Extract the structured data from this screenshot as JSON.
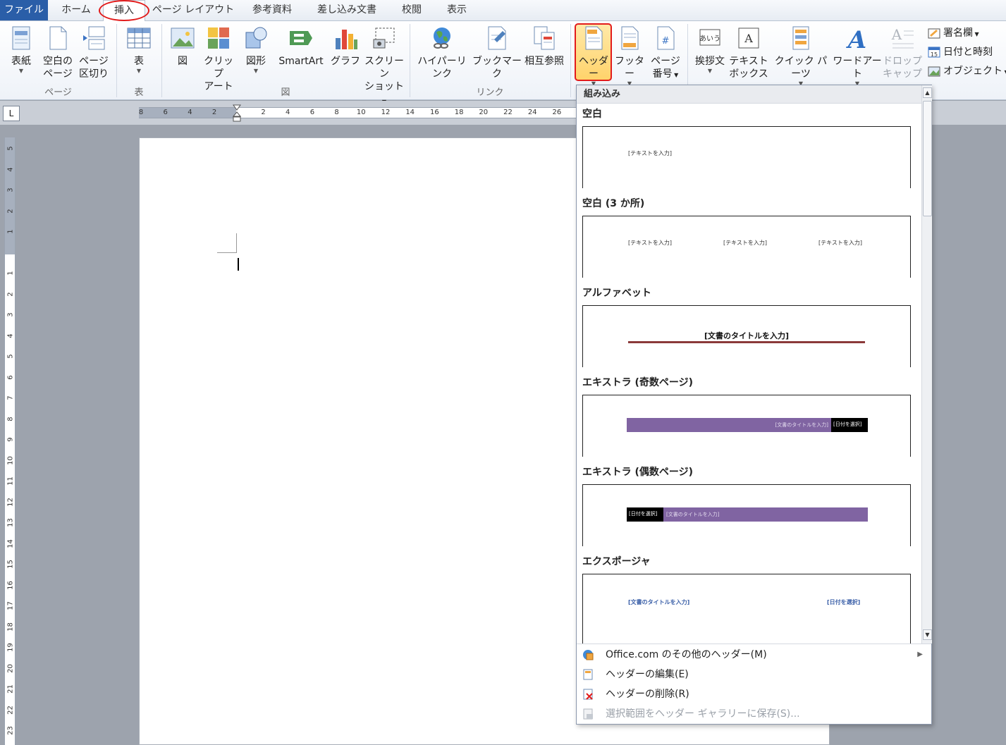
{
  "tabs": [
    "ファイル",
    "ホーム",
    "挿入",
    "ページ レイアウト",
    "参考資料",
    "差し込み文書",
    "校閲",
    "表示"
  ],
  "ribbon": {
    "pages": {
      "cover": "表紙",
      "blank_1": "空白の",
      "blank_2": "ページ",
      "break_1": "ページ",
      "break_2": "区切り",
      "group": "ページ"
    },
    "table": {
      "table": "表",
      "group": "表"
    },
    "illustrations": {
      "picture": "図",
      "clipart_1": "クリップ",
      "clipart_2": "アート",
      "shapes": "図形",
      "smartart": "SmartArt",
      "chart": "グラフ",
      "screenshot_1": "スクリーン",
      "screenshot_2": "ショット",
      "group": "図"
    },
    "links": {
      "hyperlink": "ハイパーリンク",
      "bookmark": "ブックマーク",
      "crossref": "相互参照",
      "group": "リンク"
    },
    "header_footer": {
      "header": "ヘッダー",
      "footer": "フッター",
      "pagenum_1": "ページ",
      "pagenum_2": "番号"
    },
    "text": {
      "greeting": "挨拶文",
      "textbox_1": "テキスト",
      "textbox_2": "ボックス",
      "quickparts": "クイック パーツ",
      "wordart": "ワードアート",
      "dropcap_1": "ドロップ",
      "dropcap_2": "キャップ",
      "signature": "署名欄",
      "datetime": "日付と時刻",
      "object": "オブジェクト"
    }
  },
  "ruler": {
    "corner": "L",
    "h_ticks": [
      "8",
      "6",
      "4",
      "2",
      "2",
      "4",
      "6",
      "8",
      "10",
      "12",
      "14",
      "16",
      "18",
      "20",
      "22",
      "24",
      "26"
    ],
    "v_ticks": [
      "5",
      "4",
      "3",
      "2",
      "1",
      "1",
      "2",
      "3",
      "4",
      "5",
      "6",
      "7",
      "8",
      "9",
      "10",
      "11",
      "12",
      "13",
      "14",
      "15",
      "16",
      "17",
      "18",
      "19",
      "20",
      "21",
      "22",
      "23"
    ]
  },
  "gallery": {
    "section_header": "組み込み",
    "items": [
      {
        "title": "空白",
        "placeholders": [
          "[テキストを入力]"
        ]
      },
      {
        "title": "空白 (3 か所)",
        "placeholders": [
          "[テキストを入力]",
          "[テキストを入力]",
          "[テキストを入力]"
        ]
      },
      {
        "title": "アルファベット",
        "placeholders": [
          "[文書のタイトルを入力]"
        ]
      },
      {
        "title": "エキストラ (奇数ページ)",
        "placeholders": [
          "[文書のタイトルを入力]",
          "[日付を選択]"
        ]
      },
      {
        "title": "エキストラ (偶数ページ)",
        "placeholders": [
          "[日付を選択]",
          "[文書のタイトルを入力]"
        ]
      },
      {
        "title": "エクスポージャ",
        "placeholders": [
          "[文書のタイトルを入力]",
          "[日付を選択]"
        ]
      }
    ],
    "menu": [
      {
        "label": "Office.com のその他のヘッダー(M)",
        "enabled": true
      },
      {
        "label": "ヘッダーの編集(E)",
        "enabled": true
      },
      {
        "label": "ヘッダーの削除(R)",
        "enabled": true
      },
      {
        "label": "選択範囲をヘッダー ギャラリーに保存(S)...",
        "enabled": false
      }
    ]
  },
  "colors": {
    "accent_purple": "#8064a2",
    "highlight_red": "#e21b1b",
    "file_tab": "#2a5ea8"
  }
}
